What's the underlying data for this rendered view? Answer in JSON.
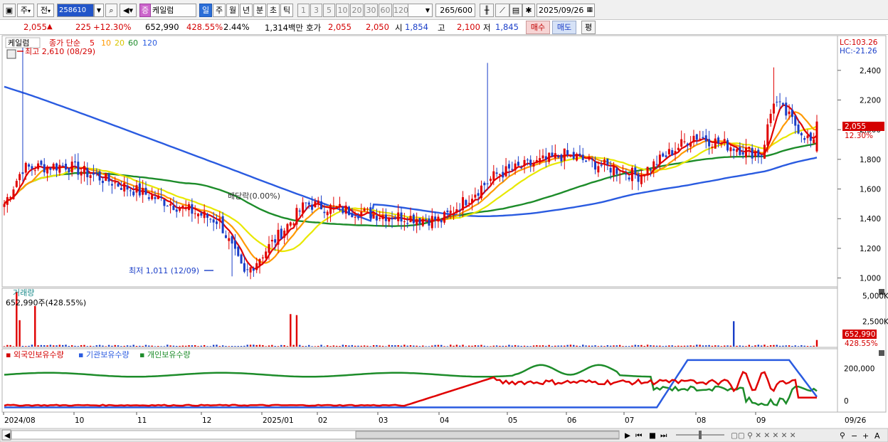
{
  "toolbar": {
    "market_label": "주",
    "prev_label": "전",
    "code": "258610",
    "stock_badge": "증",
    "stock_name": "케일럼",
    "periods": [
      "일",
      "주",
      "월",
      "년",
      "분",
      "초",
      "틱"
    ],
    "active_period": "일",
    "intervals": [
      "1",
      "3",
      "5",
      "10",
      "20",
      "30",
      "60",
      "120"
    ],
    "count": "265",
    "count_max": "600",
    "date": "2025/09/26"
  },
  "quote": {
    "price": "2,055",
    "arrow": "▲",
    "change": "225",
    "change_pct": "+12.30%",
    "volume": "652,990",
    "volume_ratio": "428.55%",
    "turnover": "2.44%",
    "amount": "1,314백만",
    "bid_ask_label": "호가",
    "ask": "2,055",
    "bid": "2,050",
    "open_label": "시",
    "open": "1,854",
    "high_label": "고",
    "high": "2,100",
    "low_label": "저",
    "low": "1,845",
    "buy_label": "매수",
    "sell_label": "매도",
    "extra_label": "평"
  },
  "price_panel": {
    "name": "케일럼",
    "ma_title": "종가 단순",
    "ma_periods": [
      "5",
      "10",
      "20",
      "60",
      "120"
    ],
    "ma_colors": [
      "#e00000",
      "#ff9900",
      "#e8e800",
      "#1d8c2a",
      "#2a5be0"
    ],
    "lc": "LC:103.26",
    "hc": "HC:-21.26",
    "y_ticks": [
      "2,400",
      "2,200",
      "2,000",
      "1,800",
      "1,600",
      "1,400",
      "1,200",
      "1,000"
    ],
    "current_price_tag": "2,055",
    "current_pct_tag": "12.30%",
    "high_note": "최고 2,610 (08/29)",
    "low_note": "최저 1,011 (12/09)",
    "dividend_note": "배당락(0.00%)"
  },
  "volume_panel": {
    "title": "거래량",
    "value_text": "652,990주(428.55%)",
    "y_ticks": [
      "5,000K",
      "2,500K"
    ],
    "current_tag": "652,990",
    "current_pct_tag": "428.55%"
  },
  "holdings_panel": {
    "series_names": [
      "외국인보유수량",
      "기관보유수량",
      "개인보유수량"
    ],
    "series_colors": [
      "#e00000",
      "#2a5be0",
      "#1d8c2a"
    ],
    "y_ticks": [
      "200,000",
      "0"
    ]
  },
  "x_axis": {
    "labels": [
      "2024/08",
      "10",
      "11",
      "12",
      "2025/01",
      "02",
      "03",
      "04",
      "05",
      "06",
      "07",
      "08",
      "09",
      "09/26"
    ]
  },
  "chart_data": {
    "type": "candlestick",
    "x_range": [
      "2024-08",
      "2025-09-26"
    ],
    "y_range": [
      950,
      2620
    ],
    "price_anchors": [
      {
        "x": "2024-08",
        "close": 1550
      },
      {
        "x": "2024-08-29",
        "high": 2610
      },
      {
        "x": "2024-09",
        "close": 1740
      },
      {
        "x": "2024-10",
        "close": 1580
      },
      {
        "x": "2024-11",
        "close": 1380
      },
      {
        "x": "2024-12-09",
        "low": 1011
      },
      {
        "x": "2025-01",
        "close": 1500
      },
      {
        "x": "2025-02",
        "close": 1430
      },
      {
        "x": "2025-03",
        "close": 1390
      },
      {
        "x": "2025-04",
        "close": 1700
      },
      {
        "x": "2025-04-mid",
        "high": 2450
      },
      {
        "x": "2025-05",
        "close": 1830
      },
      {
        "x": "2025-06",
        "close": 1690
      },
      {
        "x": "2025-07",
        "close": 1960
      },
      {
        "x": "2025-08",
        "close": 1830
      },
      {
        "x": "2025-09-mid",
        "high": 2420
      },
      {
        "x": "2025-09-26",
        "open": 1854,
        "high": 2100,
        "low": 1845,
        "close": 2055
      }
    ],
    "last_volume": 652990
  }
}
